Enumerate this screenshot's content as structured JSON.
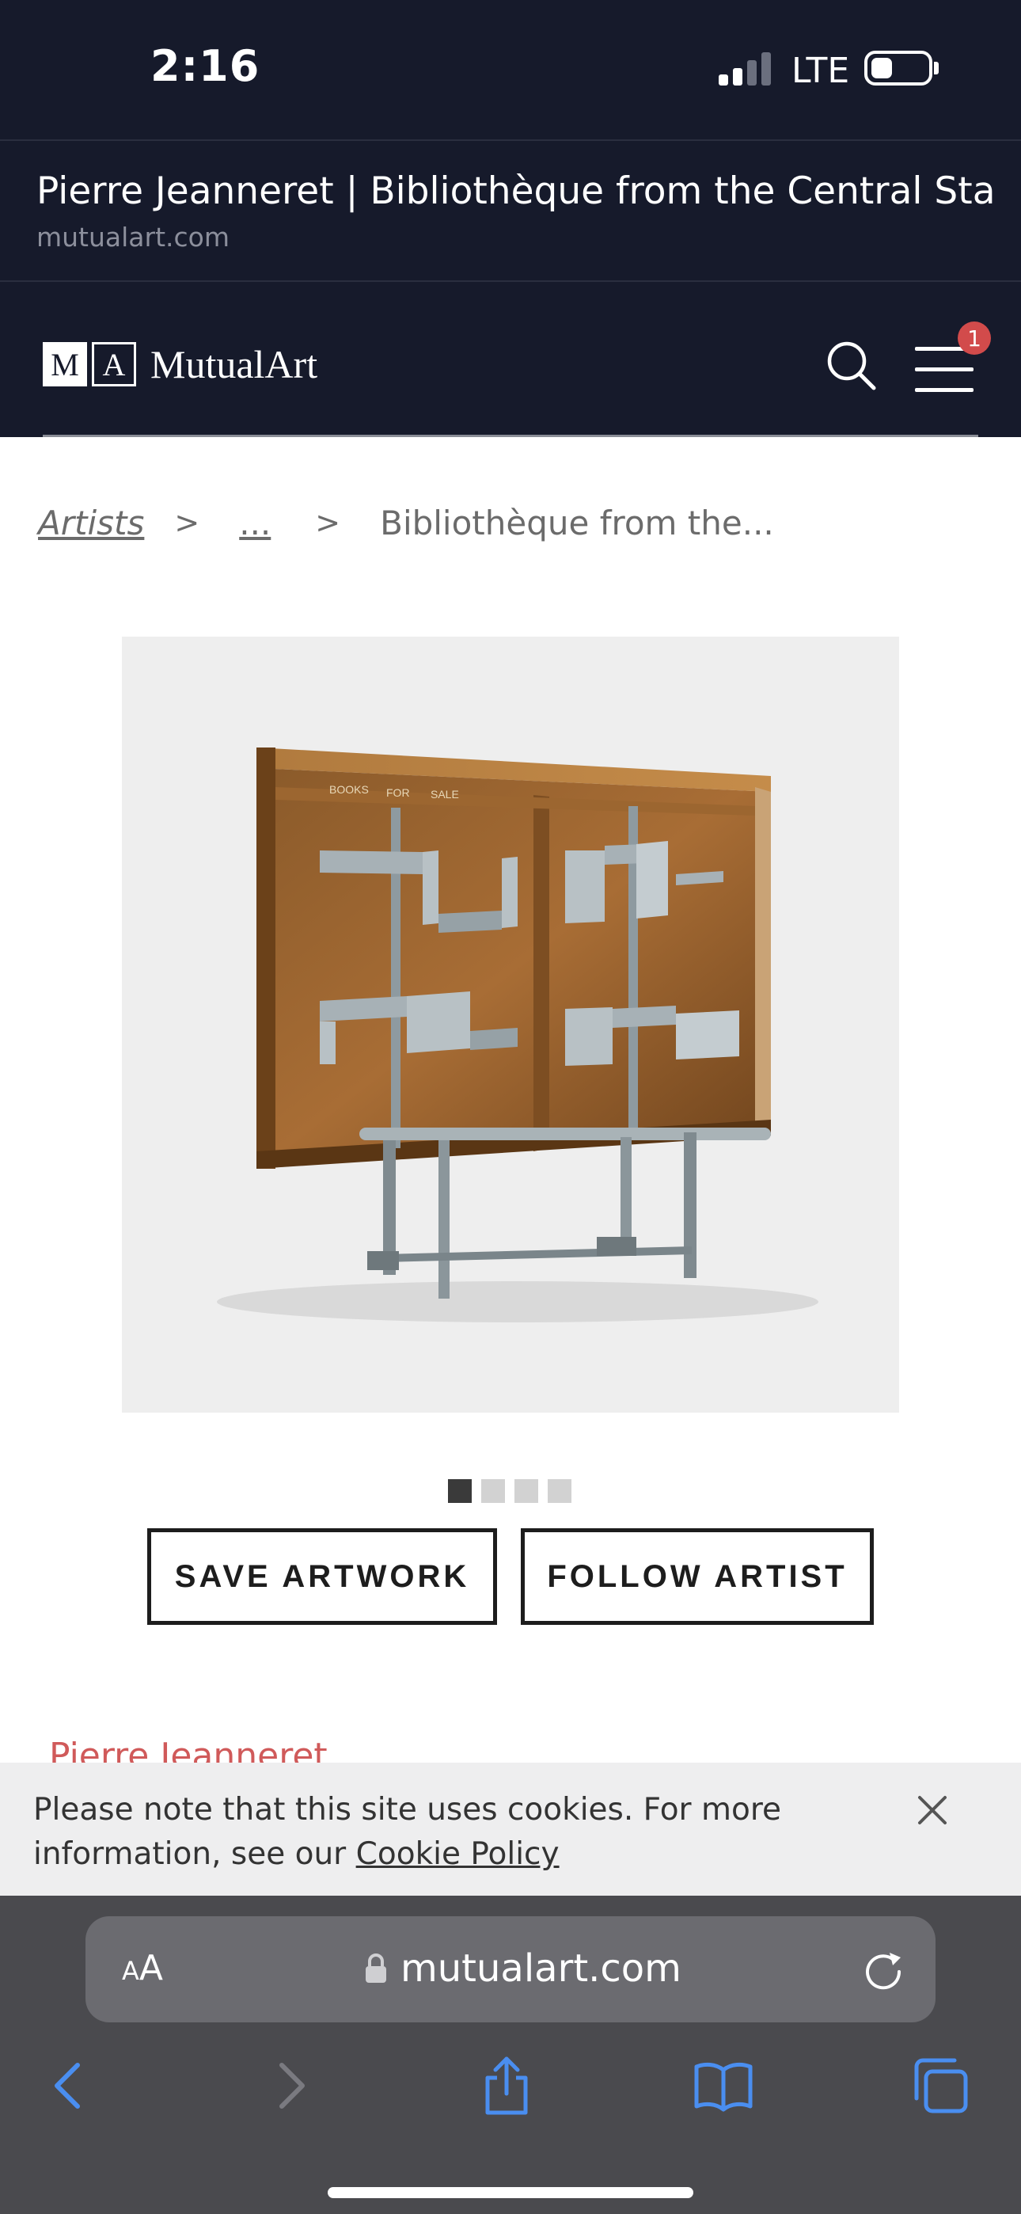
{
  "status_bar": {
    "time": "2:16",
    "network": "LTE"
  },
  "browser": {
    "page_title": "Pierre Jeanneret | Bibliothèque from the Central State...",
    "host": "mutualart.com"
  },
  "site_header": {
    "logo_letters": [
      "M",
      "A"
    ],
    "logo_text": "MutualArt",
    "notification_count": "1"
  },
  "breadcrumb": {
    "artists": "Artists",
    "ellipsis": "...",
    "separator": ">",
    "current": "Bibliothèque from the..."
  },
  "artwork": {
    "image_label_books": "BOOKS",
    "image_label_for": "FOR",
    "image_label_sale": "SALE",
    "carousel": {
      "count": 4,
      "active_index": 0
    }
  },
  "actions": {
    "save_label": "SAVE ARTWORK",
    "follow_label": "FOLLOW ARTIST"
  },
  "artist_name": "Pierre Jeanneret",
  "cookie_banner": {
    "text": "Please note that this site uses cookies. For more information, see our ",
    "link": "Cookie Policy"
  },
  "safari": {
    "aa_small": "A",
    "aa_big": "A",
    "url": "mutualart.com"
  },
  "colors": {
    "header_bg": "#161a2b",
    "accent_red": "#d05a5a",
    "safari_bg": "#4a4a4e",
    "toolbar_icon": "#4a8ef0"
  },
  "icons": {
    "search": "search-icon",
    "menu": "hamburger-menu-icon",
    "close": "close-icon",
    "lock": "lock-icon",
    "reload": "reload-icon",
    "back": "back-chevron-icon",
    "forward": "forward-chevron-icon",
    "share": "share-icon",
    "bookmarks": "bookmarks-icon",
    "tabs": "tabs-icon"
  }
}
